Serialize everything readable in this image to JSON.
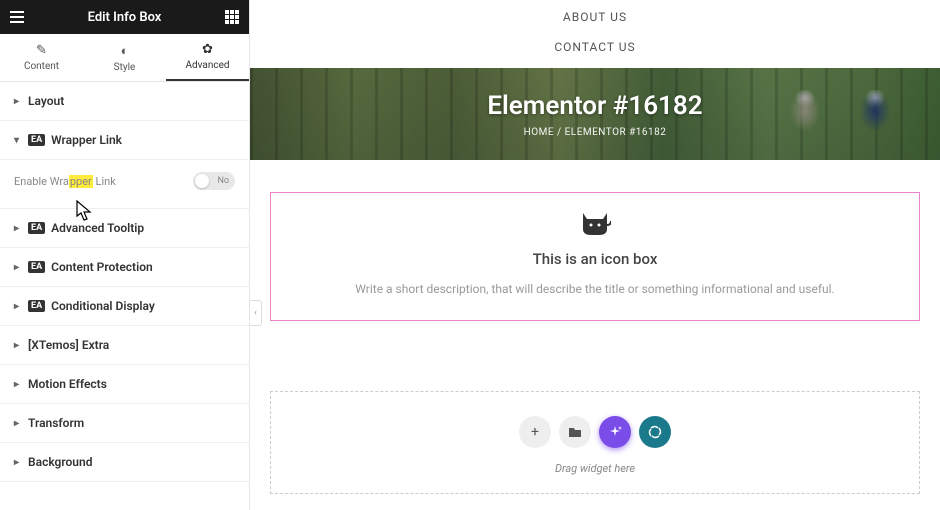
{
  "sidebar": {
    "title": "Edit Info Box",
    "tabs": {
      "content": "Content",
      "style": "Style",
      "advanced": "Advanced"
    },
    "sections": {
      "layout": "Layout",
      "wrapper_link": "Wrapper Link",
      "advanced_tooltip": "Advanced Tooltip",
      "content_protection": "Content Protection",
      "conditional_display": "Conditional Display",
      "xtemos_extra": "[XTemos] Extra",
      "motion_effects": "Motion Effects",
      "transform": "Transform",
      "background": "Background"
    },
    "controls": {
      "enable_wrapper_pre": "Enable Wra",
      "enable_wrapper_hl": "pper",
      "enable_wrapper_post": " Link",
      "toggle_no": "No"
    },
    "ea_badge": "EA"
  },
  "canvas": {
    "nav": {
      "about": "ABOUT US",
      "contact": "CONTACT US"
    },
    "hero": {
      "title": "Elementor #16182",
      "crumb_home": "HOME",
      "crumb_sep": "/",
      "crumb_current": "ELEMENTOR #16182"
    },
    "widget": {
      "title": "This is an icon box",
      "desc": "Write a short description, that will describe the title or something informational and useful."
    },
    "drop": {
      "label": "Drag widget here"
    }
  }
}
